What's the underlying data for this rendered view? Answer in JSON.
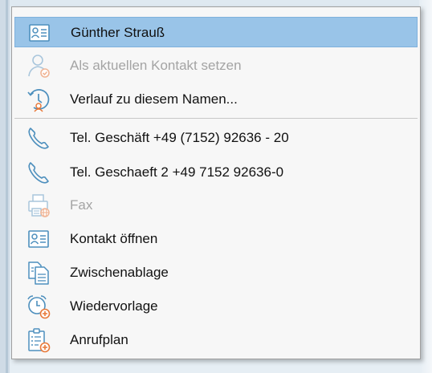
{
  "menu": {
    "items": [
      {
        "label": "Günther Strauß",
        "icon": "contact-card-icon",
        "state": "highlighted"
      },
      {
        "label": "Als aktuellen Kontakt setzen",
        "icon": "person-check-icon",
        "state": "disabled"
      },
      {
        "label": "Verlauf zu diesem Namen...",
        "icon": "history-person-icon",
        "state": "enabled"
      },
      {
        "label": "Tel. Geschäft +49 (7152) 92636 - 20",
        "icon": "phone-icon",
        "state": "enabled"
      },
      {
        "label": "Tel. Geschaeft 2 +49 7152 92636-0",
        "icon": "phone-icon",
        "state": "enabled"
      },
      {
        "label": "Fax",
        "icon": "fax-icon",
        "state": "disabled"
      },
      {
        "label": "Kontakt öffnen",
        "icon": "contact-card-icon",
        "state": "enabled"
      },
      {
        "label": "Zwischenablage",
        "icon": "clipboard-copy-icon",
        "state": "enabled"
      },
      {
        "label": "Wiedervorlage",
        "icon": "alarm-clock-add-icon",
        "state": "enabled"
      },
      {
        "label": "Anrufplan",
        "icon": "call-plan-add-icon",
        "state": "enabled"
      }
    ]
  },
  "colors": {
    "highlight": "#99c4e8",
    "icon_blue": "#4d8fbd",
    "icon_orange": "#e8793a",
    "disabled_text": "#a4a4a4"
  }
}
